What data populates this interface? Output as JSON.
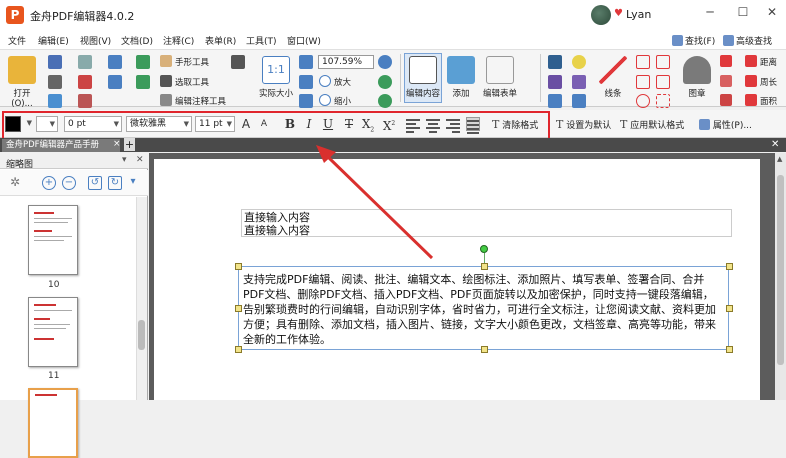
{
  "titlebar": {
    "logo_letter": "P",
    "title": "金舟PDF编辑器4.0.2",
    "username": "Lyan",
    "heart": "♥",
    "btn_min": "─",
    "btn_max": "☐",
    "btn_close": "✕"
  },
  "menu": {
    "items": [
      "文件",
      "编辑(E)",
      "视图(V)",
      "文档(D)",
      "注释(C)",
      "表单(R)",
      "工具(T)",
      "窗口(W)"
    ],
    "find": "查找(F)",
    "advanced_find": "高级查找"
  },
  "ribbon": {
    "open": "打开(O)...",
    "hand_tool": "手形工具",
    "select_tool": "选取工具",
    "edit_annot_tool": "编辑注释工具",
    "actual_size": "实际大小",
    "zoom_value": "107.59%",
    "zoom_in": "放大",
    "zoom_out": "缩小",
    "edit_content": "编辑内容",
    "add": "添加",
    "edit_form": "编辑表单",
    "lines": "线条",
    "stamp": "图章",
    "distance": "距离",
    "perimeter": "周长",
    "area": "面积"
  },
  "format": {
    "line_width": "0 pt",
    "font_name": "微软雅黑",
    "font_size": "11 pt",
    "grow_font": "A",
    "shrink_font": "A",
    "bold": "B",
    "italic": "I",
    "underline": "U",
    "strike": "T",
    "subscript": "X",
    "superscript": "X",
    "clear_format": "清除格式",
    "set_default": "设置为默认",
    "apply_default": "应用默认格式",
    "properties": "属性(P)..."
  },
  "tabs": {
    "doc_tab": "金舟PDF编辑器产品手册",
    "tab_close": "×",
    "tab_add": "+"
  },
  "sidebar": {
    "title": "缩略图",
    "page_numbers": [
      "10",
      "11"
    ]
  },
  "document": {
    "textbox1": [
      "直接输入内容",
      "直接输入内容"
    ],
    "textbox2": "支持完成PDF编辑、阅读、批注、编辑文本、绘图标注、添加照片、填写表单、签署合同、合并PDF文档、删除PDF文档、插入PDF文档、PDF页面旋转以及加密保护，同时支持一键段落编辑，告别繁琐费时的行间编辑，自动识别字体，省时省力，可进行全文标注，让您阅读文献、资料更加方便；具有删除、添加文档，插入图片、链接，文字大小颜色更改，文档签章、高亮等功能，带来全新的工作体验。"
  },
  "colors": {
    "highlight_frame": "#e0262d",
    "arrow": "#d9302e",
    "selection": "#7aa3d6"
  }
}
